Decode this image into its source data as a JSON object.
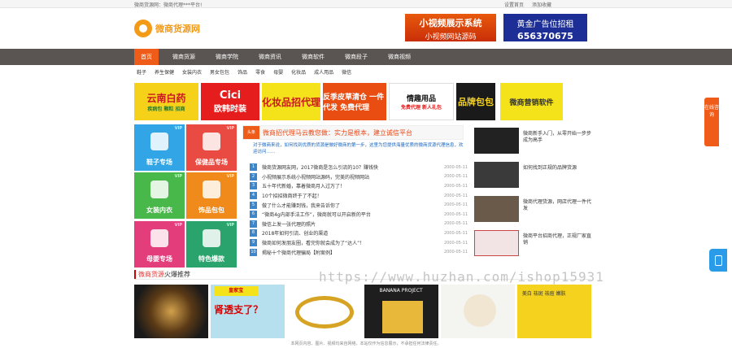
{
  "topbar": {
    "left": "微商货源网：微商代理***平台!",
    "right": [
      "设置首页",
      "添加收藏"
    ]
  },
  "logo": {
    "text": "微商货源网"
  },
  "ads": {
    "ad1": {
      "line1": "小视频展示系统",
      "line2": "小视频网站源码"
    },
    "ad2": {
      "line1": "黄金广告位招租",
      "line2": "656370675"
    }
  },
  "nav": [
    "首页",
    "微商货源",
    "微商学院",
    "微商资讯",
    "微商软件",
    "微商段子",
    "微商视频"
  ],
  "subnav": [
    "鞋子",
    "养生保健",
    "女装内衣",
    "男女包包",
    "饰品",
    "零食",
    "母婴",
    "化妆品",
    "成人用品",
    "微信"
  ],
  "banners": {
    "b1": {
      "title": "云南白药",
      "sub": "疾病包 颗粒 招商"
    },
    "b2": {
      "title": "Cici",
      "sub": "欧韩时装"
    },
    "b3": {
      "title": "化妆品招代理"
    },
    "b4": {
      "title": "反季皮草清仓 一件代发 免费代理"
    },
    "b5": {
      "title": "情趣用品",
      "sub": "免费代理 新人礼包"
    },
    "b6": {
      "title": "品牌包包"
    },
    "b7": {
      "title": "微商营销软件"
    }
  },
  "tiles": [
    {
      "label": "鞋子专场",
      "vip": "VIP"
    },
    {
      "label": "保健品专场",
      "vip": "VIP"
    },
    {
      "label": "女装内衣",
      "vip": "VIP"
    },
    {
      "label": "饰品包包",
      "vip": "VIP"
    },
    {
      "label": "母婴专场",
      "vip": "VIP"
    },
    {
      "label": "特色爆款",
      "vip": "VIP"
    }
  ],
  "headline": {
    "tag": "头条",
    "text": "微商招代理马云教您做：实力是根本，建立诚信平台"
  },
  "intro": "对于微商来说，如何找到优质的货源是做好微商的第一步，这里为您提供海量优质的微商货源代理信息，欢迎访问……",
  "news": [
    {
      "n": "1",
      "t": "微商货源网友网，2017微商是怎么引流的10？赚钱快",
      "d": "2000-05-11"
    },
    {
      "n": "2",
      "t": "小视频展示系统小视频网站源码，完美的视频网站",
      "d": "2000-05-11"
    },
    {
      "n": "3",
      "t": "五十年代新婚，靠着微商月入过万了！",
      "d": "2000-05-11"
    },
    {
      "n": "4",
      "t": "10个招招微商终于了不起！",
      "d": "2000-05-11"
    },
    {
      "n": "5",
      "t": "做了什么才能赚到钱，我来告诉你了",
      "d": "2000-05-11"
    },
    {
      "n": "6",
      "t": "“微商4g内部手法工作”，微商就可以开启新的平台",
      "d": "2000-05-11"
    },
    {
      "n": "7",
      "t": "微信上发一张代理的照片",
      "d": "2000-05-11"
    },
    {
      "n": "8",
      "t": "2018年如何引流、创业的渠道",
      "d": "2000-05-11"
    },
    {
      "n": "9",
      "t": "微商如何发朋友圈，看完你就会成为了“达人”！",
      "d": "2000-05-11"
    },
    {
      "n": "10",
      "t": "揭秘十个微商代理骗局【附案例】",
      "d": "2000-05-11"
    }
  ],
  "side": [
    {
      "cap": "微商新手入门，从零开始一步步成为高手",
      "color": "#222"
    },
    {
      "cap": "如何找到正规的品牌货源",
      "color": "#333"
    },
    {
      "cap": "微商代理货源，网店代理一件代发",
      "color": "#555"
    },
    {
      "cap": "微商平台招商代理，正规厂家直销",
      "color": "#c44"
    }
  ],
  "section": {
    "prefix": "微商货源",
    "suffix": "火爆推荐"
  },
  "products": [
    {
      "lab": ""
    },
    {
      "lab": "皇家宝",
      "big": "肾透支了？"
    },
    {
      "lab": ""
    },
    {
      "lab": "BANANA PROJECT"
    },
    {
      "lab": ""
    },
    {
      "tx": "美白 祛斑 祛痘 嫩肤"
    }
  ],
  "footer": "本网页内容、图片、视频均来自网络，本站仅作为信息展示，不承担任何法律责任。",
  "watermark": "https://www.huzhan.com/ishop15931",
  "online": "在线咨询"
}
